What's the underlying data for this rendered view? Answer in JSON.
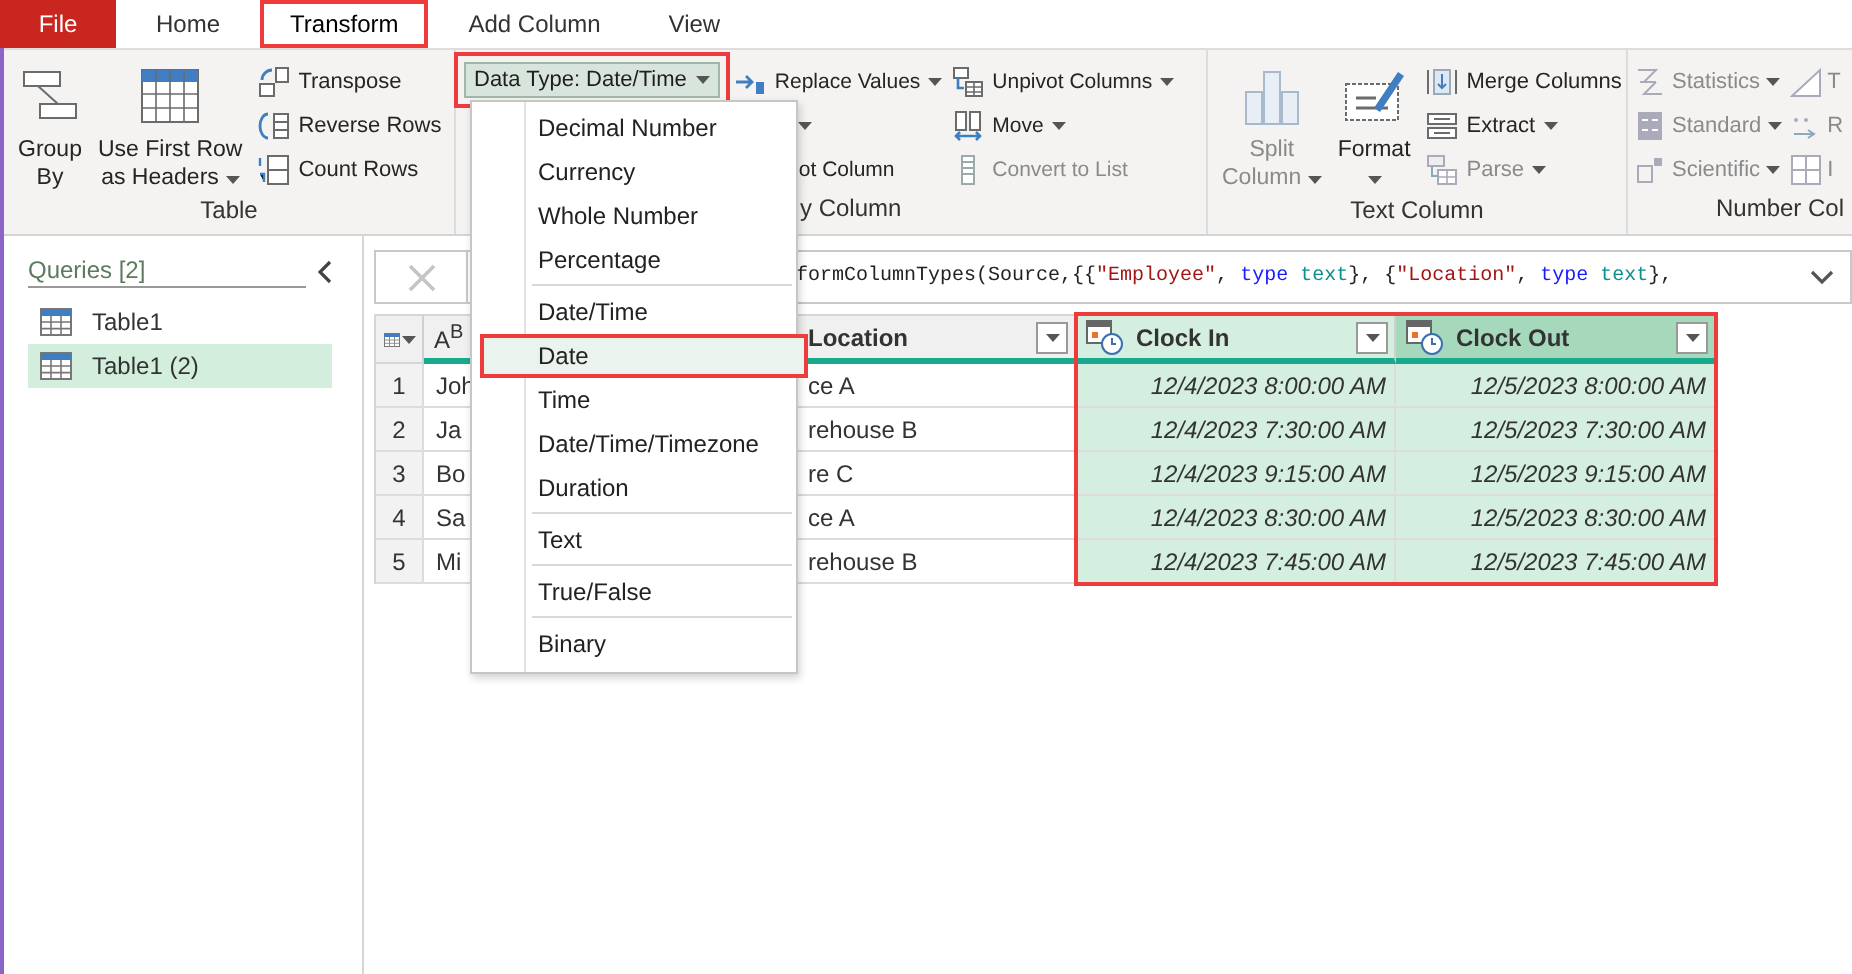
{
  "tabs": [
    {
      "label": "File",
      "kind": "file",
      "selected": false,
      "outlined": false
    },
    {
      "label": "Home",
      "kind": "tab",
      "selected": false,
      "outlined": false
    },
    {
      "label": "Transform",
      "kind": "tab",
      "selected": true,
      "outlined": true
    },
    {
      "label": "Add Column",
      "kind": "tab",
      "selected": false,
      "outlined": false
    },
    {
      "label": "View",
      "kind": "tab",
      "selected": false,
      "outlined": false
    }
  ],
  "ribbon": [
    {
      "label": "Table",
      "columns": [
        {
          "kind": "large",
          "lines": [
            "Group",
            "By"
          ],
          "dropdown": false,
          "disabled": false
        },
        {
          "kind": "large",
          "lines": [
            "Use First Row",
            "as Headers"
          ],
          "dropdown": true,
          "disabled": false
        },
        {
          "kind": "stack",
          "items": [
            {
              "label": "Transpose",
              "dropdown": false,
              "disabled": false
            },
            {
              "label": "Reverse Rows",
              "dropdown": false,
              "disabled": false
            },
            {
              "label": "Count Rows",
              "dropdown": false,
              "disabled": false
            }
          ]
        }
      ]
    },
    {
      "label": "y Column",
      "columns": [
        {
          "kind": "datatype",
          "label": "Data Type: Date/Time",
          "dropdown": true,
          "outlined": true
        },
        {
          "kind": "stack",
          "items": [
            {
              "label": "Replace Values",
              "dropdown": true,
              "disabled": false
            },
            {
              "dropdown": true,
              "disabled": false
            },
            {
              "label": "ot Column",
              "dropdown": false,
              "disabled": false
            }
          ]
        },
        {
          "kind": "stack",
          "items": [
            {
              "label": "Unpivot Columns",
              "dropdown": true,
              "disabled": false
            },
            {
              "label": "Move",
              "dropdown": true,
              "disabled": false
            },
            {
              "label": "Convert to List",
              "dropdown": false,
              "disabled": true
            }
          ]
        }
      ]
    },
    {
      "label": "Text Column",
      "columns": [
        {
          "kind": "large",
          "lines": [
            "Split",
            "Column"
          ],
          "dropdown": true,
          "disabled": true
        },
        {
          "kind": "large",
          "lines": [
            "Format"
          ],
          "dropdown": true,
          "disabled": false
        },
        {
          "kind": "stack",
          "items": [
            {
              "label": "Merge Columns",
              "dropdown": false,
              "disabled": false
            },
            {
              "label": "Extract",
              "dropdown": true,
              "disabled": false
            },
            {
              "label": "Parse",
              "dropdown": true,
              "disabled": true
            }
          ]
        }
      ]
    },
    {
      "label": "Number Col",
      "columns": [
        {
          "kind": "stack",
          "items": [
            {
              "label": "Statistics",
              "dropdown": true,
              "disabled": true
            },
            {
              "label": "Standard",
              "dropdown": true,
              "disabled": true
            },
            {
              "label": "Scientific",
              "dropdown": true,
              "disabled": true
            }
          ]
        },
        {
          "kind": "stack",
          "items": [
            {
              "label": "T",
              "dropdown": false,
              "disabled": true
            },
            {
              "label": "R",
              "dropdown": false,
              "disabled": true
            },
            {
              "label": "I",
              "dropdown": false,
              "disabled": true
            }
          ]
        }
      ]
    }
  ],
  "data_type_menu": [
    [
      {
        "label": "Decimal Number",
        "selected": false,
        "outlined": false
      },
      {
        "label": "Currency",
        "selected": false,
        "outlined": false
      },
      {
        "label": "Whole Number",
        "selected": false,
        "outlined": false
      },
      {
        "label": "Percentage",
        "selected": false,
        "outlined": false
      }
    ],
    [
      {
        "label": "Date/Time",
        "selected": false,
        "outlined": false
      },
      {
        "label": "Date",
        "selected": true,
        "outlined": true
      },
      {
        "label": "Time",
        "selected": false,
        "outlined": false
      },
      {
        "label": "Date/Time/Timezone",
        "selected": false,
        "outlined": false
      },
      {
        "label": "Duration",
        "selected": false,
        "outlined": false
      }
    ],
    [
      {
        "label": "Text",
        "selected": false,
        "outlined": false
      }
    ],
    [
      {
        "label": "True/False",
        "selected": false,
        "outlined": false
      }
    ],
    [
      {
        "label": "Binary",
        "selected": false,
        "outlined": false
      }
    ]
  ],
  "queries": {
    "title": "Queries [2]",
    "items": [
      {
        "label": "Table1",
        "selected": false
      },
      {
        "label": "Table1 (2)",
        "selected": true
      }
    ]
  },
  "formula": [
    {
      "kind": "plain",
      "text": "formColumnTypes(Source,{{"
    },
    {
      "kind": "string",
      "text": "\"Employee\""
    },
    {
      "kind": "plain",
      "text": ", "
    },
    {
      "kind": "keyword",
      "text": "type"
    },
    {
      "kind": "typename",
      "text": " text"
    },
    {
      "kind": "plain",
      "text": "}, {"
    },
    {
      "kind": "string",
      "text": "\"Location\""
    },
    {
      "kind": "plain",
      "text": ", "
    },
    {
      "kind": "keyword",
      "text": "type"
    },
    {
      "kind": "typename",
      "text": " text"
    },
    {
      "kind": "plain",
      "text": "},"
    }
  ],
  "table": {
    "selection_outlined": true,
    "columns": [
      {
        "kind": "text",
        "type_glyph": "A$^{B}$",
        "selected": false,
        "focused": false
      },
      {
        "kind": "hidden",
        "name": "Location",
        "selected": false,
        "focused": false
      },
      {
        "kind": "datetime",
        "name": "Clock In",
        "selected": true,
        "focused": false
      },
      {
        "kind": "datetime",
        "name": "Clock Out",
        "selected": true,
        "focused": true
      }
    ],
    "rows": [
      {
        "number": "1",
        "cells": [
          "Joh",
          "ce A",
          "12/4/2023 8:00:00 AM",
          "12/5/2023 8:00:00 AM"
        ]
      },
      {
        "number": "2",
        "cells": [
          "Ja",
          "rehouse B",
          "12/4/2023 7:30:00 AM",
          "12/5/2023 7:30:00 AM"
        ]
      },
      {
        "number": "3",
        "cells": [
          "Bo",
          "re C",
          "12/4/2023 9:15:00 AM",
          "12/5/2023 9:15:00 AM"
        ]
      },
      {
        "number": "4",
        "cells": [
          "Sa",
          "ce A",
          "12/4/2023 8:30:00 AM",
          "12/5/2023 8:30:00 AM"
        ]
      },
      {
        "number": "5",
        "cells": [
          "Mi",
          "rehouse B",
          "12/4/2023 7:45:00 AM",
          "12/5/2023 7:45:00 AM"
        ]
      }
    ]
  }
}
